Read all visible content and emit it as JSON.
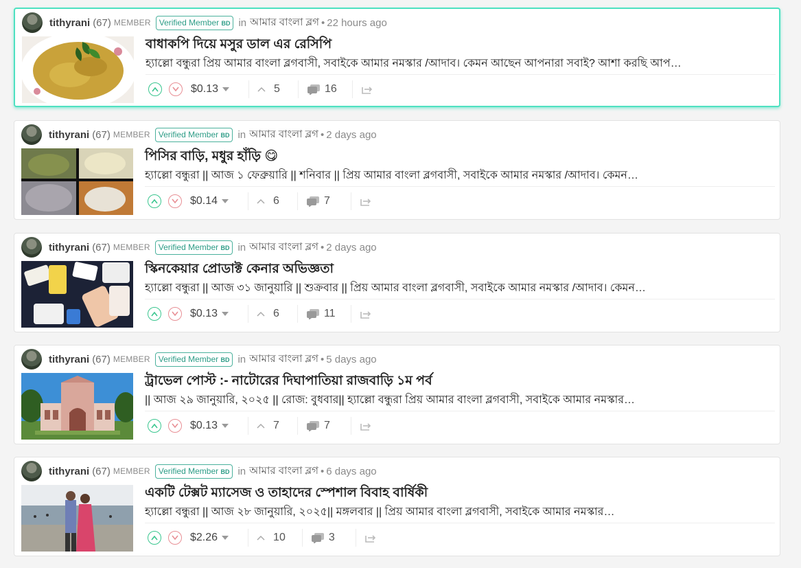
{
  "posts": [
    {
      "author": "tithyrani",
      "reputation": "(67)",
      "role": "MEMBER",
      "badge": "Verified Member",
      "badge_suffix": "BD",
      "in_label": "in",
      "community": "আমার বাংলা ব্লগ",
      "bullet": "•",
      "time": "22 hours ago",
      "title": "বাধাকপি দিয়ে মসুর ডাল এর রেসিপি",
      "excerpt": "হ্যাল্লো বন্ধুরা প্রিয় আমার বাংলা ব্লগবাসী, সবাইকে আমার নমস্কার /আদাব। কেমন আছেন আপনারা সবাই? আশা করছি আপ…",
      "payout": "$0.13",
      "votes": "5",
      "comments": "16",
      "thumb": "curry"
    },
    {
      "author": "tithyrani",
      "reputation": "(67)",
      "role": "MEMBER",
      "badge": "Verified Member",
      "badge_suffix": "BD",
      "in_label": "in",
      "community": "আমার বাংলা ব্লগ",
      "bullet": "•",
      "time": "2 days ago",
      "title": "পিসির বাড়ি, মধুর হাঁড়ি 😋",
      "excerpt": "হ্যাল্লো বন্ধুরা || আজ ১ ফেব্রুয়ারি || শনিবার || প্রিয় আমার বাংলা ব্লগবাসী, সবাইকে আমার নমস্কার /আদাব। কেমন…",
      "payout": "$0.14",
      "votes": "6",
      "comments": "7",
      "thumb": "collage"
    },
    {
      "author": "tithyrani",
      "reputation": "(67)",
      "role": "MEMBER",
      "badge": "Verified Member",
      "badge_suffix": "BD",
      "in_label": "in",
      "community": "আমার বাংলা ব্লগ",
      "bullet": "•",
      "time": "2 days ago",
      "title": "স্কিনকেয়ার প্রোডাক্ট কেনার অভিজ্ঞতা",
      "excerpt": "হ্যাল্লো বন্ধুরা || আজ ৩১ জানুয়ারি || শুক্রবার || প্রিয় আমার বাংলা ব্লগবাসী, সবাইকে আমার নমস্কার /আদাব। কেমন…",
      "payout": "$0.13",
      "votes": "6",
      "comments": "11",
      "thumb": "skincare"
    },
    {
      "author": "tithyrani",
      "reputation": "(67)",
      "role": "MEMBER",
      "badge": "Verified Member",
      "badge_suffix": "BD",
      "in_label": "in",
      "community": "আমার বাংলা ব্লগ",
      "bullet": "•",
      "time": "5 days ago",
      "title": "ট্রাভেল পোস্ট :- নাটোরের দিঘাপাতিয়া রাজবাড়ি ১ম পর্ব",
      "excerpt": "|| আজ ২৯ জানুয়ারি, ২০২৫ || রোজ: বুধবার|| হ্যাল্লো বন্ধুরা প্রিয় আমার বাংলা ব্লগবাসী, সবাইকে আমার নমস্কার…",
      "payout": "$0.13",
      "votes": "7",
      "comments": "7",
      "thumb": "palace"
    },
    {
      "author": "tithyrani",
      "reputation": "(67)",
      "role": "MEMBER",
      "badge": "Verified Member",
      "badge_suffix": "BD",
      "in_label": "in",
      "community": "আমার বাংলা ব্লগ",
      "bullet": "•",
      "time": "6 days ago",
      "title": "একটি টেক্সট ম্যাসেজ ও তাহাদের স্পেশাল বিবাহ বার্ষিকী",
      "excerpt": "হ্যাল্লো বন্ধুরা || আজ ২৮ জানুয়ারি, ২০২৫|| মঙ্গলবার || প্রিয় আমার বাংলা ব্লগবাসী, সবাইকে আমার নমস্কার…",
      "payout": "$2.26",
      "votes": "10",
      "comments": "3",
      "thumb": "beach"
    }
  ],
  "colors": {
    "accent": "#4ee1c1",
    "upvote": "#3ac68f",
    "downvote": "#e88f95",
    "badge": "#2c9c86"
  }
}
